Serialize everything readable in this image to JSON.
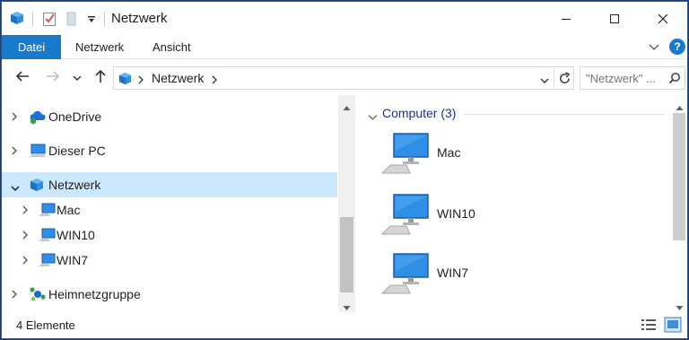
{
  "window": {
    "title": "Netzwerk"
  },
  "quick_access": {
    "app_icon": "network-icon",
    "properties_icon": "properties-check-icon",
    "new_folder_icon": "new-folder-icon",
    "customize_icon": "dropdown-arrow-icon"
  },
  "ribbon": {
    "tabs": [
      "Datei",
      "Netzwerk",
      "Ansicht"
    ]
  },
  "address_bar": {
    "breadcrumb": "Netzwerk"
  },
  "search": {
    "placeholder": "\"Netzwerk\" ..."
  },
  "tree": {
    "items": [
      {
        "label": "OneDrive",
        "icon": "onedrive-cloud-icon"
      },
      {
        "label": "Dieser PC",
        "icon": "pc-icon"
      },
      {
        "label": "Netzwerk",
        "icon": "network-icon",
        "selected": true,
        "expanded": true
      },
      {
        "label": "Mac",
        "icon": "computer-icon"
      },
      {
        "label": "WIN10",
        "icon": "computer-icon"
      },
      {
        "label": "WIN7",
        "icon": "computer-icon"
      },
      {
        "label": "Heimnetzgruppe",
        "icon": "homegroup-icon"
      }
    ]
  },
  "content": {
    "group_header": "Computer (3)",
    "items": [
      {
        "label": "Mac",
        "icon": "computer-icon"
      },
      {
        "label": "WIN10",
        "icon": "computer-icon"
      },
      {
        "label": "WIN7",
        "icon": "computer-icon"
      }
    ]
  },
  "status_bar": {
    "count": "4 Elemente"
  },
  "colors": {
    "accent": "#1979ca",
    "selection": "#cce8ff",
    "group_header": "#1e3287",
    "frame": "#2b5797"
  }
}
